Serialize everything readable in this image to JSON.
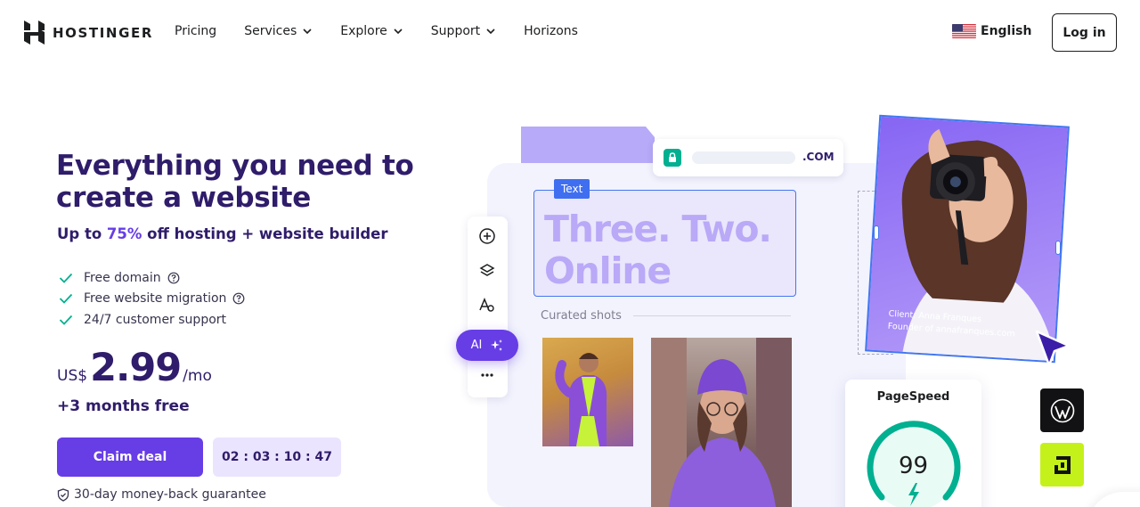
{
  "brand": {
    "name": "HOSTINGER",
    "accent_color": "#673de6",
    "dark_color": "#2f1c6a"
  },
  "nav": {
    "links": [
      {
        "label": "Pricing",
        "dropdown": false
      },
      {
        "label": "Services",
        "dropdown": true
      },
      {
        "label": "Explore",
        "dropdown": true
      },
      {
        "label": "Support",
        "dropdown": true
      },
      {
        "label": "Horizons",
        "dropdown": false
      }
    ],
    "language": {
      "label": "English",
      "flag_icon": "us-flag-icon"
    },
    "login_label": "Log in"
  },
  "hero": {
    "title": "Everything you need to create a website",
    "subtitle_prefix": "Up to ",
    "subtitle_accent": "75%",
    "subtitle_suffix": " off hosting + website builder",
    "features": [
      {
        "label": "Free domain",
        "has_help": true
      },
      {
        "label": "Free website migration",
        "has_help": true
      },
      {
        "label": "24/7 customer support",
        "has_help": false
      }
    ],
    "price": {
      "currency": "US$",
      "amount": "2.99",
      "period": "/mo"
    },
    "bonus": "+3 months free",
    "cta_label": "Claim deal",
    "timer": "02 : 03 : 10 : 47",
    "guarantee": "30-day money-back guarantee"
  },
  "showcase": {
    "url_suffix": ".COM",
    "text_tag": "Text",
    "headline": "Three. Two. Online",
    "curated_label": "Curated shots",
    "ai_label": "AI",
    "toolbar_icons": [
      "add-icon",
      "layers-icon",
      "text-style-icon",
      "more-icon"
    ],
    "client_name": "Client: Anna Franques",
    "client_role": "Founder of annafranques.com",
    "pagespeed_title": "PageSpeed",
    "pagespeed_score": "99",
    "pagespeed_color": "#00b090"
  }
}
